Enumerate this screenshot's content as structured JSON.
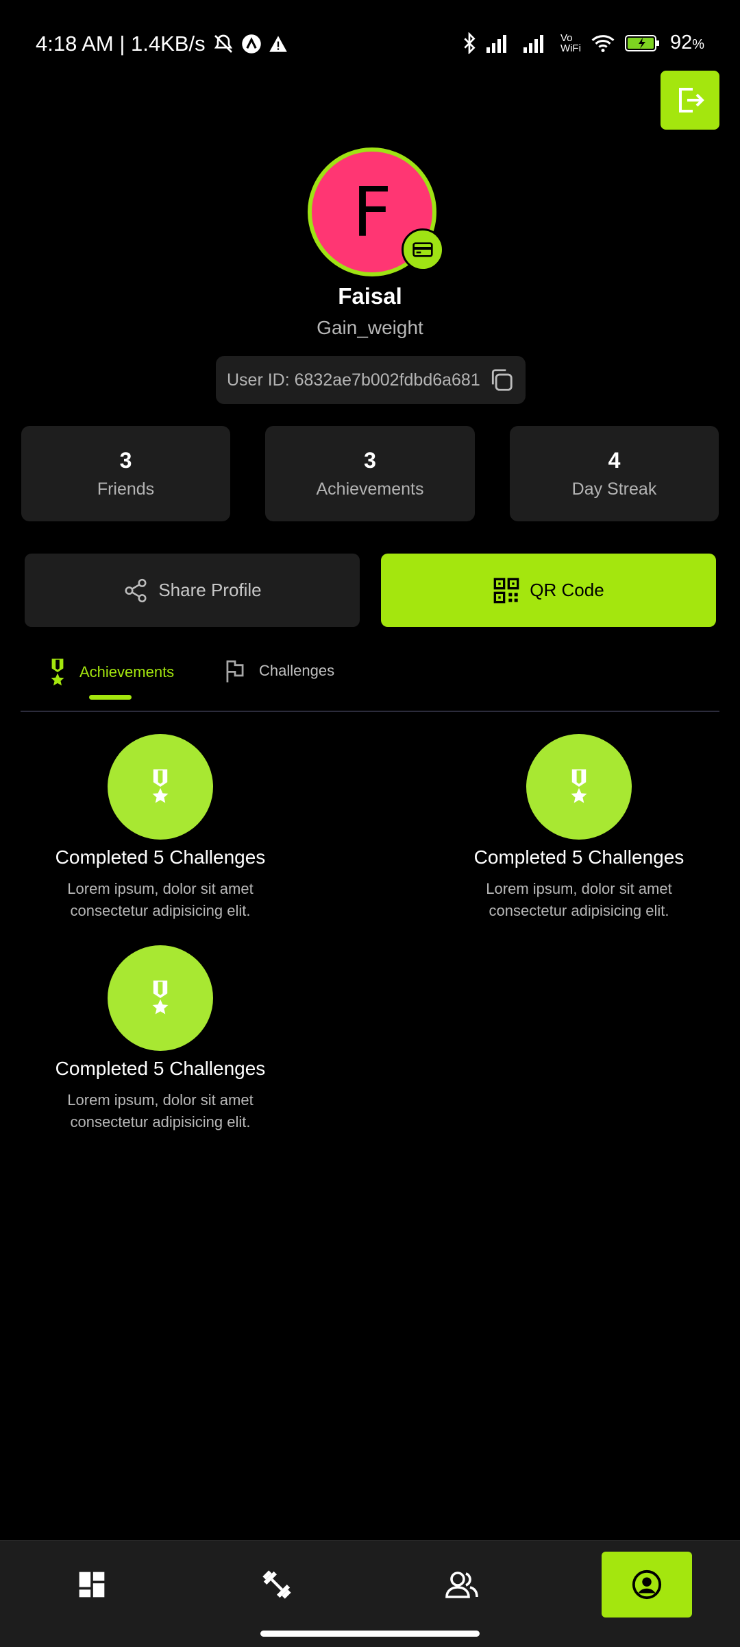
{
  "status_bar": {
    "time_speed": "4:18 AM | 1.4KB/s",
    "battery": "92",
    "battery_unit": "%",
    "network_label_top": "Vo",
    "network_label_bottom": "WiFi"
  },
  "profile": {
    "avatar_letter": "F",
    "name": "Faisal",
    "goal": "Gain_weight",
    "user_id": "User ID: 6832ae7b002fdbd6a681"
  },
  "stats": [
    {
      "value": "3",
      "label": "Friends"
    },
    {
      "value": "3",
      "label": "Achievements"
    },
    {
      "value": "4",
      "label": "Day Streak"
    }
  ],
  "actions": {
    "share_label": "Share Profile",
    "qr_label": "QR Code"
  },
  "tabs": {
    "achievements": "Achievements",
    "challenges": "Challenges"
  },
  "achievements": [
    {
      "title": "Completed 5 Challenges",
      "desc_line1": "Lorem ipsum, dolor sit amet",
      "desc_line2": "consectetur adipisicing elit."
    },
    {
      "title": "Completed 5 Challenges",
      "desc_line1": "Lorem ipsum, dolor sit amet",
      "desc_line2": "consectetur adipisicing elit."
    },
    {
      "title": "Completed 5 Challenges",
      "desc_line1": "Lorem ipsum, dolor sit amet",
      "desc_line2": "consectetur adipisicing elit."
    }
  ],
  "nav": [
    {
      "icon": "dashboard-icon"
    },
    {
      "icon": "dumbbell-icon"
    },
    {
      "icon": "friends-icon"
    },
    {
      "icon": "profile-icon",
      "active": true
    }
  ],
  "colors": {
    "accent": "#a4e60e",
    "avatar_bg": "#ff3673",
    "card_bg": "#1e1e1e",
    "background": "#000000"
  }
}
